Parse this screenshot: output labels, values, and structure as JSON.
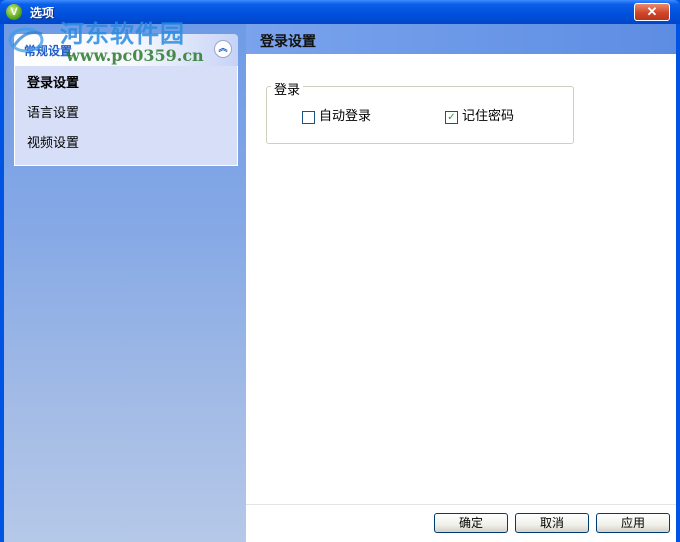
{
  "window": {
    "title": "选项",
    "app_icon_letter": "V",
    "close_glyph": "✕"
  },
  "watermark": {
    "brand": "河东软件园",
    "url": "www.pc0359.cn"
  },
  "sidebar": {
    "group_label": "常规设置",
    "collapse_glyph": "︽",
    "items": [
      {
        "label": "登录设置",
        "active": true
      },
      {
        "label": "语言设置",
        "active": false
      },
      {
        "label": "视频设置",
        "active": false
      }
    ]
  },
  "main": {
    "title": "登录设置",
    "fieldset_legend": "登录",
    "options": [
      {
        "label": "自动登录",
        "checked": false
      },
      {
        "label": "记住密码",
        "checked": true
      }
    ]
  },
  "footer": {
    "ok_label": "确定",
    "cancel_label": "取消",
    "apply_label": "应用"
  },
  "icons": {
    "check_glyph": "✓"
  }
}
